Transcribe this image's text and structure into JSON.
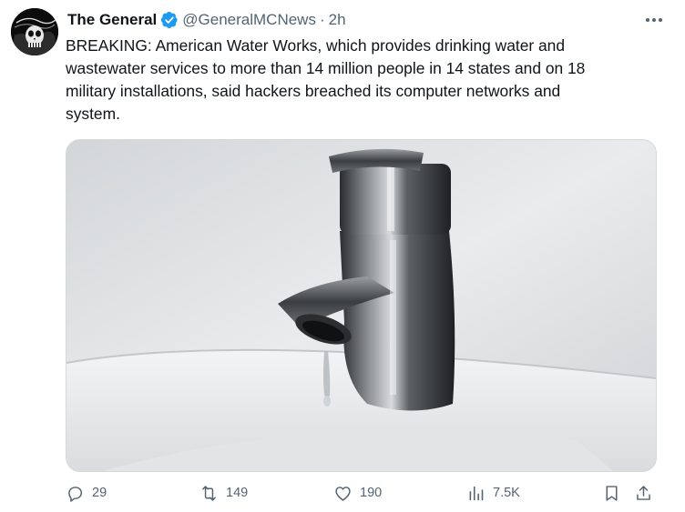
{
  "author": {
    "name": "The General",
    "handle": "@GeneralMCNews",
    "time_sep": "·",
    "time": "2h"
  },
  "tweet": {
    "text": "BREAKING: American Water Works, which provides drinking water and\nwastewater services to more than 14 million people in 14 states and on 18\nmilitary installations, said hackers breached its computer networks and\nsystem."
  },
  "stats": {
    "replies": "29",
    "retweets": "149",
    "likes": "190",
    "views": "7.5K"
  },
  "colors": {
    "verified": "#1d9bf0",
    "secondary_text": "#536471",
    "media_border": "#cfd9de"
  },
  "icons": [
    "avatar-skull",
    "verified-badge-icon",
    "more-icon",
    "reply-icon",
    "retweet-icon",
    "like-icon",
    "views-icon",
    "bookmark-icon",
    "share-icon"
  ]
}
